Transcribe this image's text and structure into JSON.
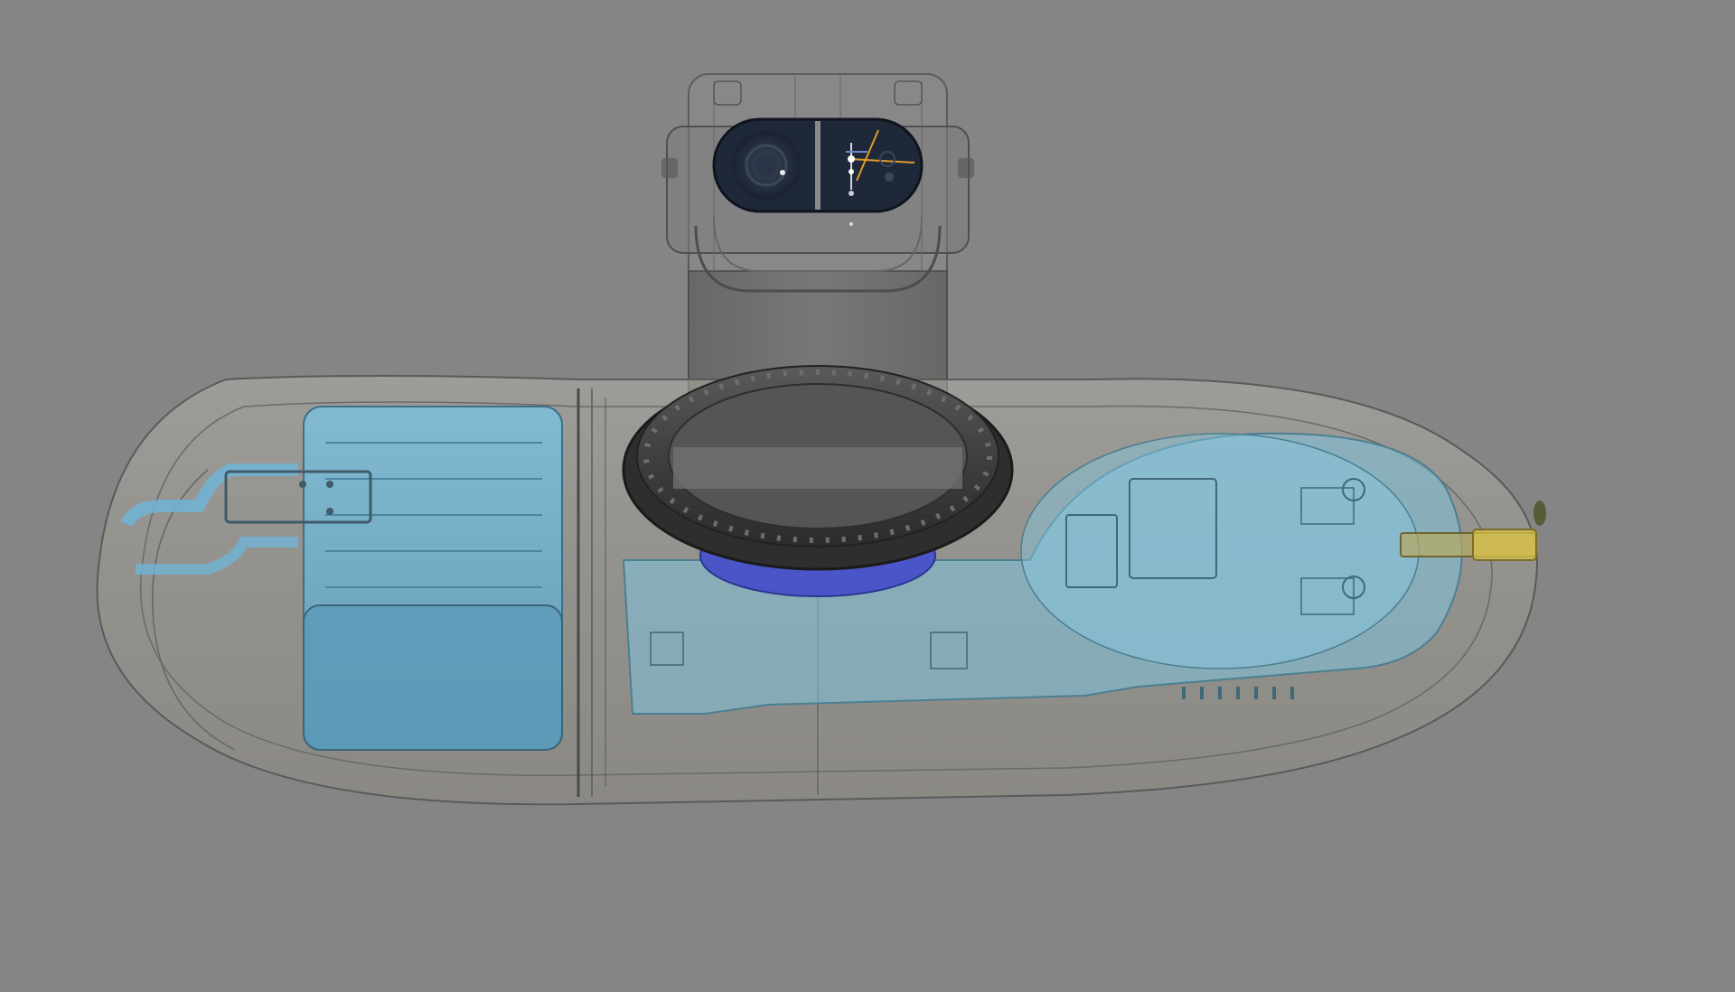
{
  "viewport": {
    "background": "#858585"
  },
  "colors": {
    "housing_fill": "#a8a49b",
    "housing_stroke": "#5a5a5a",
    "battery": "#6fb4d6",
    "pcb": "#7fc4de",
    "lens_bezel": "#1e2838",
    "dial": "#4c4c4c",
    "accent_orange": "#e09a2c",
    "accent_blue": "#4a56c8",
    "connector_gold": "#d8c24a"
  },
  "icons": {
    "lens": "camera-lens-icon",
    "sensor": "sensor-window-icon",
    "dial": "rotary-dial-icon",
    "battery": "battery-pack-icon",
    "board": "circuit-board-icon",
    "connector": "usb-connector-icon"
  }
}
